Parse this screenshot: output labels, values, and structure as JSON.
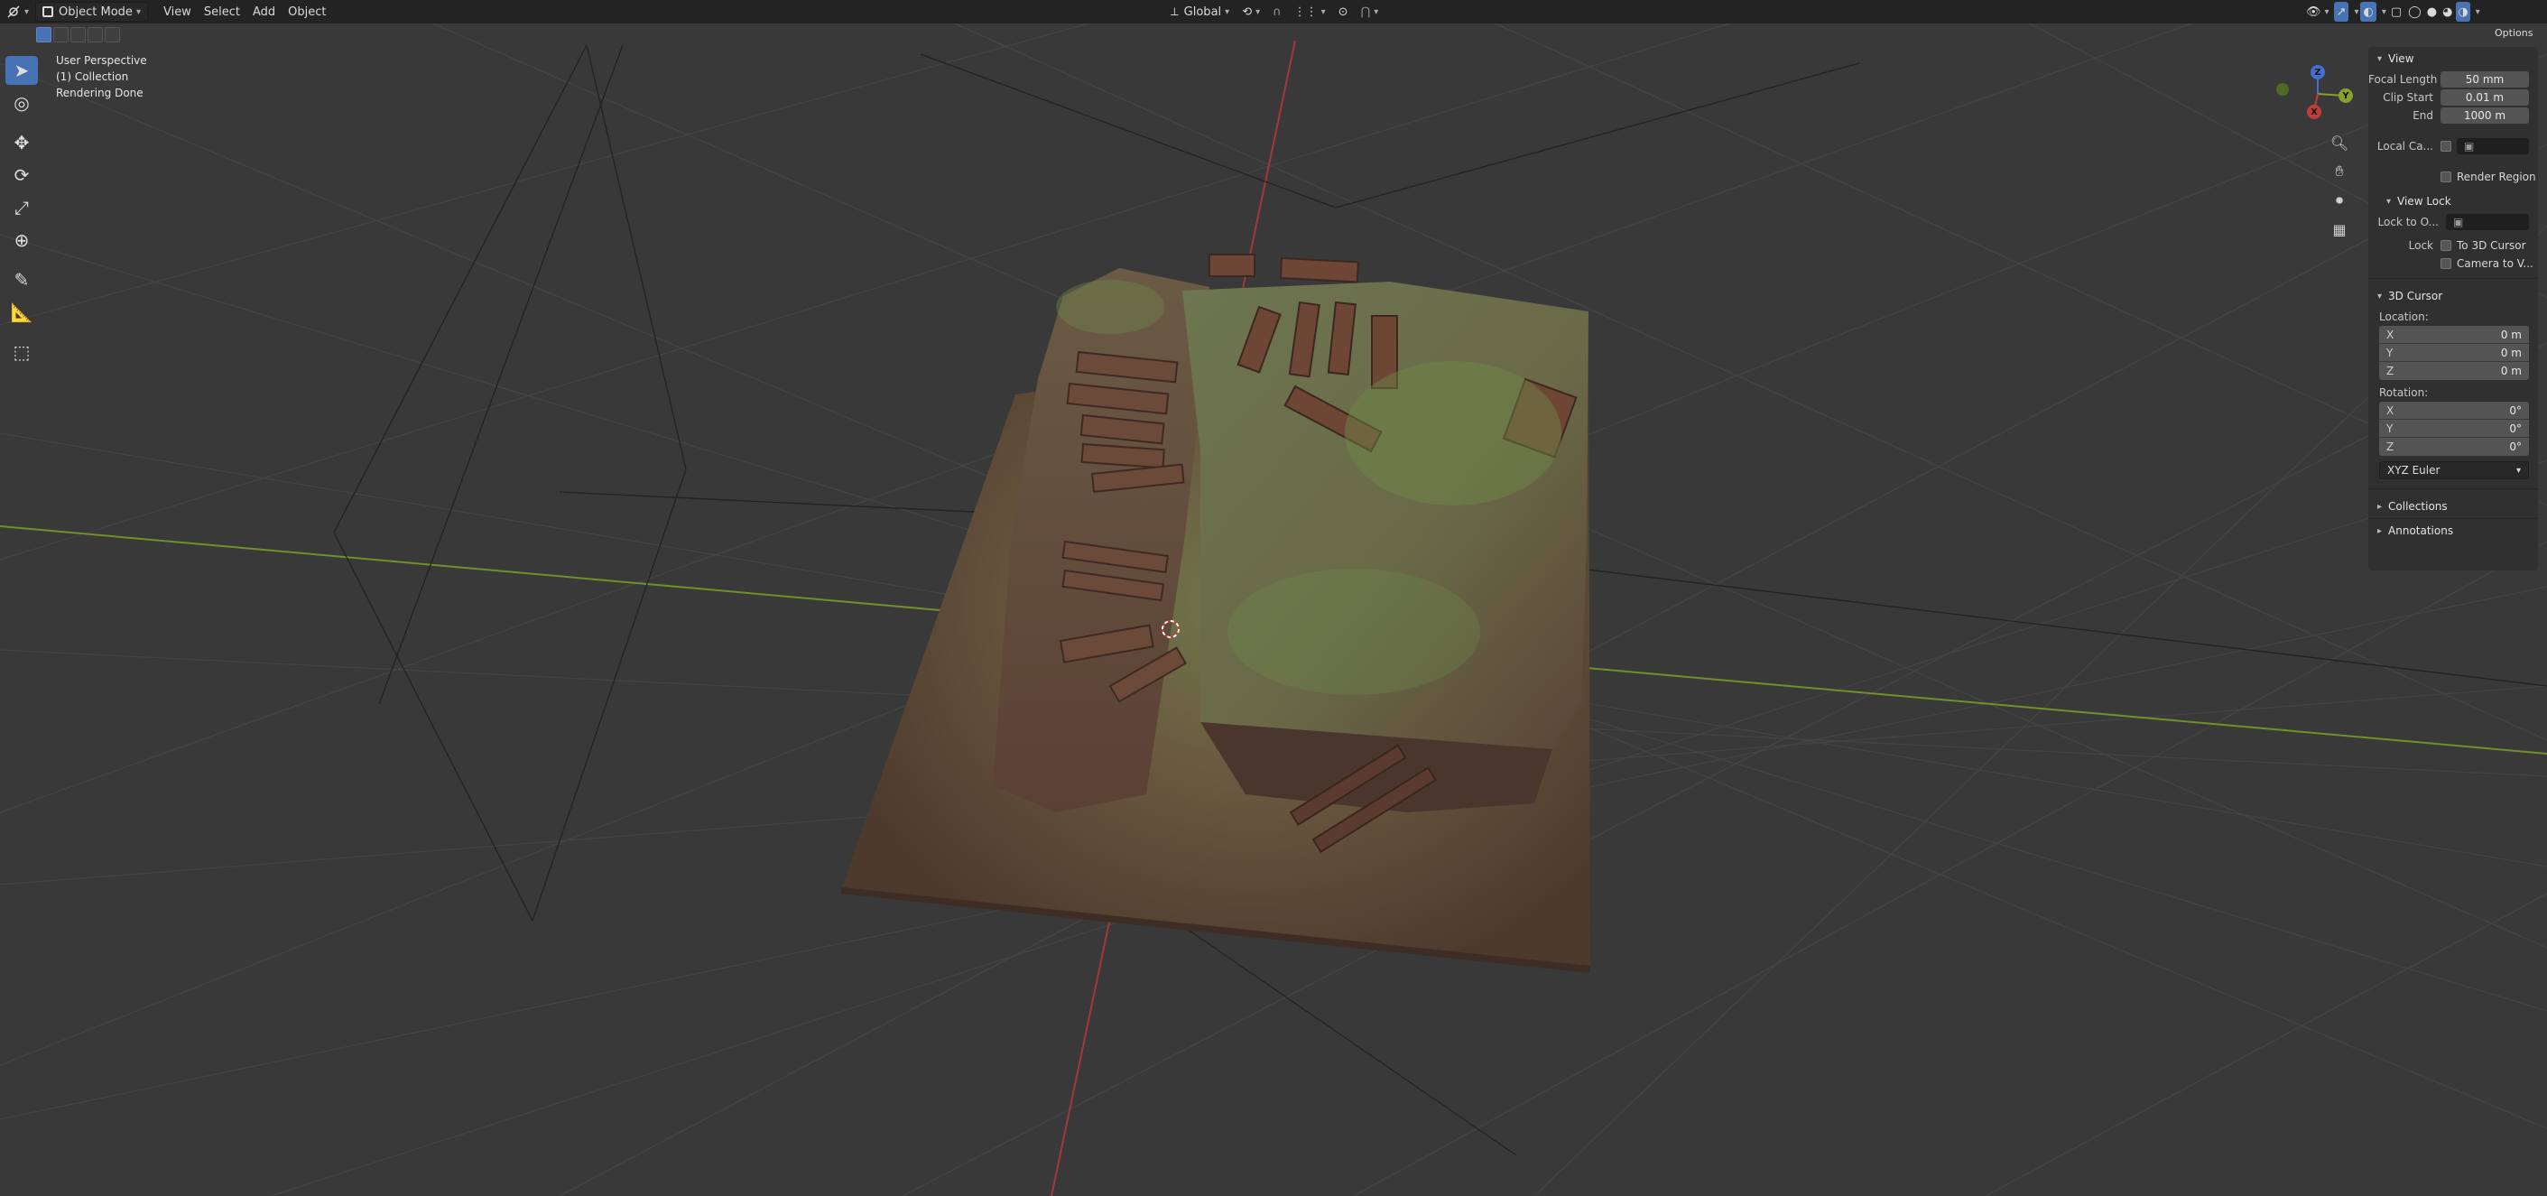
{
  "header": {
    "editor_type_icon": "3d-viewport-icon",
    "mode": "Object Mode",
    "menus": [
      "View",
      "Select",
      "Add",
      "Object"
    ],
    "transform_orientation": "Global",
    "options_label": "Options"
  },
  "overlay": {
    "view_name": "User Perspective",
    "collection": "(1) Collection",
    "status": "Rendering Done"
  },
  "gizmo": {
    "x": "X",
    "y": "Y",
    "z": "Z"
  },
  "sidebar": {
    "view": {
      "title": "View",
      "focal_length_label": "Focal Length",
      "focal_length": "50 mm",
      "clip_start_label": "Clip Start",
      "clip_start": "0.01 m",
      "clip_end_label": "End",
      "clip_end": "1000 m",
      "local_camera_label": "Local Ca...",
      "render_region_label": "Render Region"
    },
    "view_lock": {
      "title": "View Lock",
      "lock_to_object_label": "Lock to O...",
      "lock_label": "Lock",
      "to_3d_cursor_label": "To 3D Cursor",
      "camera_to_view_label": "Camera to V..."
    },
    "cursor": {
      "title": "3D Cursor",
      "location_label": "Location:",
      "location": [
        {
          "axis": "X",
          "value": "0 m"
        },
        {
          "axis": "Y",
          "value": "0 m"
        },
        {
          "axis": "Z",
          "value": "0 m"
        }
      ],
      "rotation_label": "Rotation:",
      "rotation": [
        {
          "axis": "X",
          "value": "0°"
        },
        {
          "axis": "Y",
          "value": "0°"
        },
        {
          "axis": "Z",
          "value": "0°"
        }
      ],
      "rotation_mode": "XYZ Euler"
    },
    "collections_title": "Collections",
    "annotations_title": "Annotations"
  },
  "colors": {
    "viewport_bg": "#393939",
    "grid": "#4a4a4a",
    "x_axis": "#b03a3a",
    "y_axis": "#7a9a2a",
    "accent": "#4772b3"
  }
}
